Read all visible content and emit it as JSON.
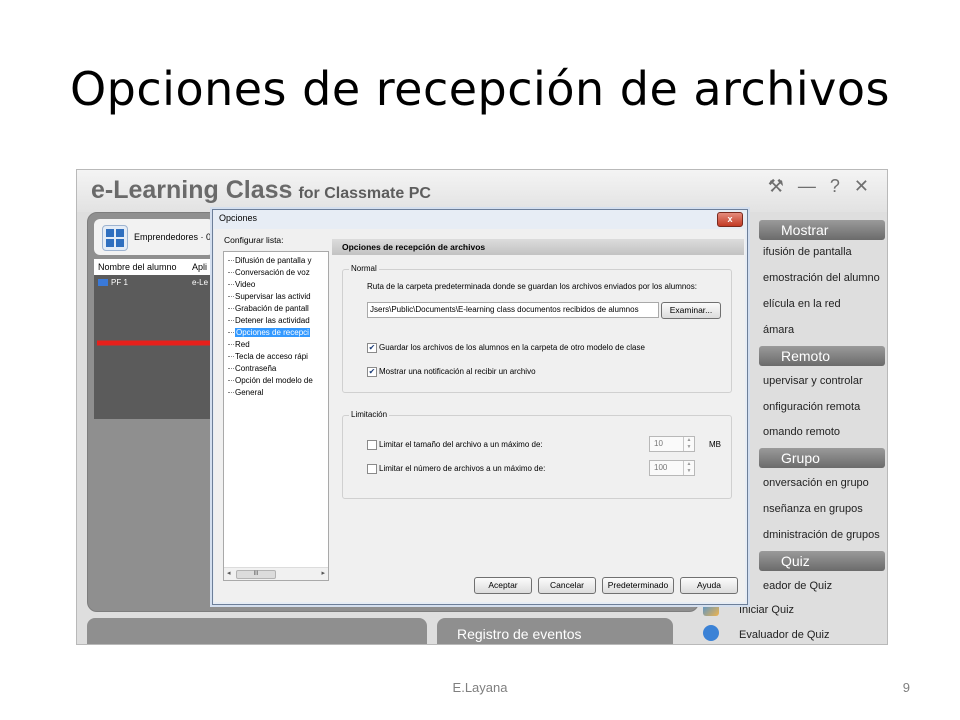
{
  "slide": {
    "title": "Opciones de recepción de archivos",
    "author": "E.Layana",
    "page": "9"
  },
  "app": {
    "name": "e-Learning Class",
    "name_suffix": "for Classmate PC",
    "window_controls": [
      "⚒",
      "—",
      "?",
      "✕"
    ],
    "toolbar_label": "Emprendedores · 0",
    "student_table": {
      "headers": [
        "Nombre del alumno",
        "Apli"
      ],
      "rows": [
        {
          "name": "PF 1",
          "app": "e-Le"
        }
      ]
    },
    "event_log_title": "Registro de eventos",
    "right_menu": {
      "sections": [
        {
          "title": "Mostrar",
          "items": [
            "ifusión de pantalla",
            "emostración del alumno",
            "elícula en la red",
            "ámara"
          ]
        },
        {
          "title": "Remoto",
          "items": [
            "upervisar y controlar",
            "onfiguración remota",
            "omando remoto"
          ]
        },
        {
          "title": "Grupo",
          "items": [
            "onversación en grupo",
            "nseñanza en grupos",
            "dministración de grupos"
          ]
        },
        {
          "title": "Quiz",
          "items": [
            "eador de Quiz",
            "Iniciar Quiz",
            "Evaluador de Quiz"
          ]
        }
      ]
    }
  },
  "dialog": {
    "title": "Opciones",
    "close_label": "x",
    "config_label": "Configurar lista:",
    "tree": [
      {
        "label": "Difusión de pantalla y",
        "selected": false
      },
      {
        "label": "Conversación de voz",
        "selected": false
      },
      {
        "label": "Video",
        "selected": false
      },
      {
        "label": "Supervisar las activid",
        "selected": false
      },
      {
        "label": "Grabación de pantall",
        "selected": false
      },
      {
        "label": "Detener las actividad",
        "selected": false
      },
      {
        "label": "Opciones de recepci",
        "selected": true
      },
      {
        "label": "Red",
        "selected": false
      },
      {
        "label": "Tecla de acceso rápi",
        "selected": false
      },
      {
        "label": "Contraseña",
        "selected": false
      },
      {
        "label": "Opción del modelo de",
        "selected": false
      },
      {
        "label": "General",
        "selected": false
      }
    ],
    "tree_scroll": {
      "left": "◂",
      "thumb": "III",
      "right": "▸"
    },
    "section_title": "Opciones de recepción de archivos",
    "normal": {
      "label": "Normal",
      "description": "Ruta de la carpeta predeterminada donde se guardan los archivos enviados por los alumnos:",
      "path": "Jsers\\Public\\Documents\\E-learning class documentos recibidos de alumnos",
      "browse_label": "Examinar...",
      "checkbox_save": {
        "label": "Guardar los archivos de los alumnos en la carpeta de otro modelo de clase",
        "checked": true
      },
      "checkbox_notify": {
        "label": "Mostrar una notificación al recibir un archivo",
        "checked": true
      }
    },
    "limit": {
      "label": "Limitación",
      "size": {
        "label": "Limitar el tamaño del archivo a un máximo de:",
        "checked": false,
        "value": "10",
        "unit": "MB"
      },
      "count": {
        "label": "Limitar el número de archivos a un máximo de:",
        "checked": false,
        "value": "100"
      }
    },
    "buttons": {
      "accept": "Aceptar",
      "cancel": "Cancelar",
      "default": "Predeterminado",
      "help": "Ayuda"
    },
    "check_mark": "✔",
    "spin_up": "▲",
    "spin_down": "▼"
  },
  "colors": {
    "arrow": "#e8201b",
    "selection": "#3399ff",
    "section_header": "#7a7a7a"
  }
}
